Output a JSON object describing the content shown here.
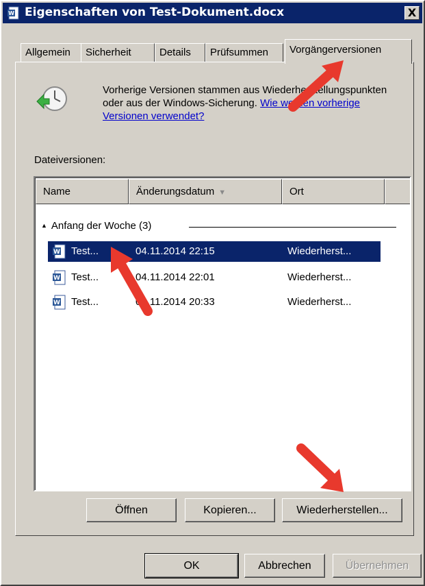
{
  "window": {
    "title": "Eigenschaften von Test-Dokument.docx",
    "close_label": "X"
  },
  "tabs": [
    {
      "label": "Allgemein"
    },
    {
      "label": "Sicherheit"
    },
    {
      "label": "Details"
    },
    {
      "label": "Prüfsummen"
    },
    {
      "label": "Vorgängerversionen",
      "active": true
    }
  ],
  "info": {
    "text": "Vorherige Versionen stammen aus Wiederherstellungspunkten oder aus der Windows-Sicherung.",
    "link": "Wie werden vorherige Versionen verwendet?"
  },
  "versions_label": "Dateiversionen:",
  "columns": {
    "name": "Name",
    "date": "Änderungsdatum",
    "location": "Ort"
  },
  "group": {
    "label": "Anfang der Woche (3)"
  },
  "rows": [
    {
      "name": "Test...",
      "date": "04.11.2014 22:15",
      "location": "Wiederherst..."
    },
    {
      "name": "Test...",
      "date": "04.11.2014 22:01",
      "location": "Wiederherst..."
    },
    {
      "name": "Test...",
      "date": "04.11.2014 20:33",
      "location": "Wiederherst..."
    }
  ],
  "list_buttons": {
    "open": "Öffnen",
    "copy": "Kopieren...",
    "restore": "Wiederherstellen..."
  },
  "dialog_buttons": {
    "ok": "OK",
    "cancel": "Abbrechen",
    "apply": "Übernehmen"
  },
  "colors": {
    "titlebar": "#0a246a",
    "selection": "#0a246a",
    "link": "#0000cc",
    "annotation_arrow": "#e8392d",
    "face": "#d4d0c8"
  }
}
